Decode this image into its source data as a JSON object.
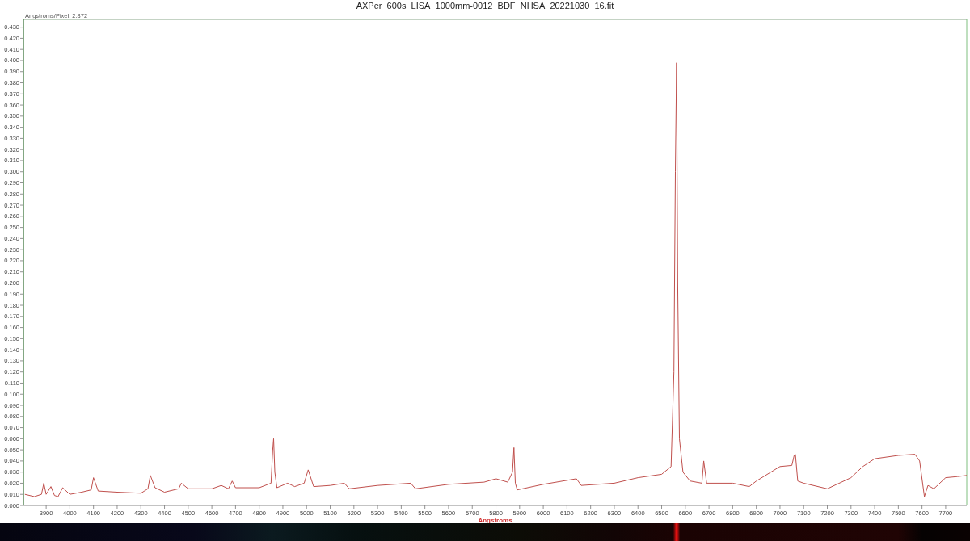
{
  "window": {
    "title": "AXPer_600s_LISA_1000mm-0012_BDF_NHSA_20221030_16.fit"
  },
  "plot": {
    "scale_note": "Angstroms/Pixel: 2.872",
    "chart_data": {
      "type": "line",
      "xlabel": "Angstroms",
      "xlim": [
        3804,
        7789
      ],
      "ylim": [
        0,
        0.437
      ],
      "xticks": [
        3900,
        4000,
        4100,
        4200,
        4300,
        4400,
        4500,
        4600,
        4700,
        4800,
        4900,
        5000,
        5100,
        5200,
        5300,
        5400,
        5500,
        5600,
        5700,
        5800,
        5900,
        6000,
        6100,
        6200,
        6300,
        6400,
        6500,
        6600,
        6700,
        6800,
        6900,
        7000,
        7100,
        7200,
        7300,
        7400,
        7500,
        7600,
        7700
      ],
      "yticks": [
        {
          "value": 0,
          "label": "0.000"
        },
        {
          "value": 0.01,
          "label": "0.010"
        },
        {
          "value": 0.02,
          "label": "0.020"
        },
        {
          "value": 0.03,
          "label": "0.030"
        },
        {
          "value": 0.04,
          "label": "0.040"
        },
        {
          "value": 0.05,
          "label": "0.050"
        },
        {
          "value": 0.06,
          "label": "0.060"
        },
        {
          "value": 0.07,
          "label": "0.070"
        },
        {
          "value": 0.08,
          "label": "0.080"
        },
        {
          "value": 0.09,
          "label": "0.090"
        },
        {
          "value": 0.1,
          "label": "0.100"
        },
        {
          "value": 0.11,
          "label": "0.110"
        },
        {
          "value": 0.12,
          "label": "0.120"
        },
        {
          "value": 0.13,
          "label": "0.130"
        },
        {
          "value": 0.14,
          "label": "0.140"
        },
        {
          "value": 0.15,
          "label": "0.150"
        },
        {
          "value": 0.16,
          "label": "0.160"
        },
        {
          "value": 0.17,
          "label": "0.170"
        },
        {
          "value": 0.18,
          "label": "0.180"
        },
        {
          "value": 0.19,
          "label": "0.190"
        },
        {
          "value": 0.2,
          "label": "0.200"
        },
        {
          "value": 0.21,
          "label": "0.210"
        },
        {
          "value": 0.22,
          "label": "0.220"
        },
        {
          "value": 0.23,
          "label": "0.230"
        },
        {
          "value": 0.24,
          "label": "0.240"
        },
        {
          "value": 0.25,
          "label": "0.250"
        },
        {
          "value": 0.26,
          "label": "0.260"
        },
        {
          "value": 0.27,
          "label": "0.270"
        },
        {
          "value": 0.28,
          "label": "0.280"
        },
        {
          "value": 0.29,
          "label": "0.290"
        },
        {
          "value": 0.3,
          "label": "0.300"
        },
        {
          "value": 0.31,
          "label": "0.310"
        },
        {
          "value": 0.32,
          "label": "0.320"
        },
        {
          "value": 0.33,
          "label": "0.330"
        },
        {
          "value": 0.34,
          "label": "0.340"
        },
        {
          "value": 0.35,
          "label": "0.350"
        },
        {
          "value": 0.36,
          "label": "0.360"
        },
        {
          "value": 0.37,
          "label": "0.370"
        },
        {
          "value": 0.38,
          "label": "0.380"
        },
        {
          "value": 0.39,
          "label": "0.390"
        },
        {
          "value": 0.4,
          "label": "0.400"
        },
        {
          "value": 0.41,
          "label": "0.410"
        },
        {
          "value": 0.42,
          "label": "0.420"
        },
        {
          "value": 0.43,
          "label": "0.430"
        }
      ],
      "x": [
        3810,
        3850,
        3880,
        3890,
        3900,
        3920,
        3935,
        3950,
        3970,
        4000,
        4050,
        4090,
        4100,
        4120,
        4200,
        4300,
        4330,
        4340,
        4360,
        4400,
        4460,
        4471,
        4500,
        4600,
        4640,
        4670,
        4686,
        4700,
        4800,
        4850,
        4857,
        4861,
        4866,
        4875,
        4920,
        4950,
        4990,
        5007,
        5030,
        5100,
        5160,
        5180,
        5300,
        5440,
        5460,
        5600,
        5750,
        5800,
        5850,
        5870,
        5876,
        5882,
        5890,
        6000,
        6140,
        6160,
        6300,
        6400,
        6500,
        6540,
        6552,
        6558,
        6563,
        6568,
        6575,
        6590,
        6620,
        6670,
        6678,
        6690,
        6800,
        6870,
        6900,
        7000,
        7050,
        7060,
        7065,
        7075,
        7100,
        7200,
        7300,
        7350,
        7400,
        7500,
        7570,
        7590,
        7610,
        7625,
        7650,
        7700,
        7750,
        7789
      ],
      "series": [
        {
          "color": "#c0504d",
          "values": [
            0.01,
            0.008,
            0.01,
            0.02,
            0.01,
            0.017,
            0.009,
            0.008,
            0.016,
            0.01,
            0.012,
            0.014,
            0.025,
            0.013,
            0.012,
            0.011,
            0.015,
            0.027,
            0.016,
            0.012,
            0.015,
            0.02,
            0.015,
            0.015,
            0.018,
            0.015,
            0.022,
            0.016,
            0.016,
            0.02,
            0.05,
            0.06,
            0.03,
            0.016,
            0.02,
            0.017,
            0.02,
            0.032,
            0.017,
            0.018,
            0.02,
            0.015,
            0.018,
            0.02,
            0.015,
            0.019,
            0.021,
            0.024,
            0.021,
            0.03,
            0.052,
            0.02,
            0.014,
            0.019,
            0.024,
            0.018,
            0.02,
            0.025,
            0.028,
            0.035,
            0.12,
            0.3,
            0.398,
            0.2,
            0.06,
            0.03,
            0.022,
            0.02,
            0.04,
            0.02,
            0.02,
            0.017,
            0.022,
            0.035,
            0.036,
            0.045,
            0.046,
            0.022,
            0.02,
            0.015,
            0.025,
            0.035,
            0.042,
            0.045,
            0.046,
            0.04,
            0.008,
            0.018,
            0.015,
            0.025,
            0.026,
            0.027
          ]
        }
      ]
    }
  }
}
